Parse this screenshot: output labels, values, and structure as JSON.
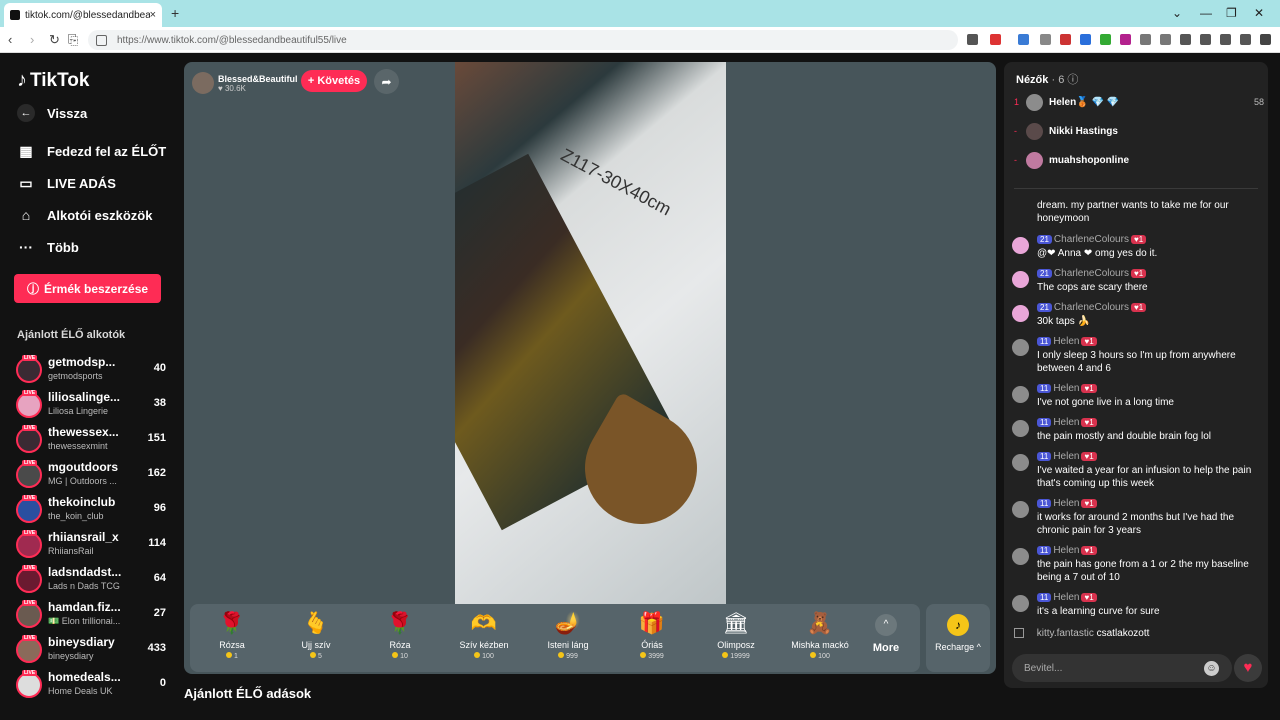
{
  "browser": {
    "tab_title": "tiktok.com/@blessedandbeau",
    "url": "https://www.tiktok.com/@blessedandbeautiful55/live"
  },
  "sidebar": {
    "logo": "TikTok",
    "back": "Vissza",
    "nav": [
      {
        "label": "Fedezd fel az ÉLŐT",
        "icon": "calendar-icon"
      },
      {
        "label": "LIVE ADÁS",
        "icon": "camera-icon"
      },
      {
        "label": "Alkotói eszközök",
        "icon": "creator-tools-icon"
      },
      {
        "label": "Több",
        "icon": "more-dots-icon"
      }
    ],
    "buy_coins": "Érmék beszerzése",
    "suggested_title": "Ajánlott ÉLŐ alkotók",
    "creators": [
      {
        "name": "getmodsp...",
        "sub": "getmodsports",
        "count": "40"
      },
      {
        "name": "liliosalinge...",
        "sub": "Liliosa Lingerie",
        "count": "38"
      },
      {
        "name": "thewessex...",
        "sub": "thewessexmint",
        "count": "151"
      },
      {
        "name": "mgoutdoors",
        "sub": "MG | Outdoors ...",
        "count": "162"
      },
      {
        "name": "thekoinclub",
        "sub": "the_koin_club",
        "count": "96"
      },
      {
        "name": "rhiiansrail_x",
        "sub": "RhiiansRail",
        "count": "114"
      },
      {
        "name": "ladsndadst...",
        "sub": "Lads n Dads TCG",
        "count": "64"
      },
      {
        "name": "hamdan.fiz...",
        "sub": "💵 Elon trillionai...",
        "count": "27"
      },
      {
        "name": "bineysdiary",
        "sub": "bineysdiary",
        "count": "433"
      },
      {
        "name": "homedeals...",
        "sub": "Home Deals UK",
        "count": "0"
      }
    ]
  },
  "player": {
    "host_name": "Blessed&Beautiful",
    "host_likes": "30.6K",
    "follow": "+ Követés",
    "video_code": "Z117-30X40cm",
    "gifts": [
      {
        "name": "Rózsa",
        "price": "1",
        "icon": "🌹"
      },
      {
        "name": "Ujj szív",
        "price": "5",
        "icon": "🫰"
      },
      {
        "name": "Róza",
        "price": "10",
        "icon": "🌹"
      },
      {
        "name": "Szív kézben",
        "price": "100",
        "icon": "🫶"
      },
      {
        "name": "Isteni láng",
        "price": "999",
        "icon": "🪔"
      },
      {
        "name": "Óriás",
        "price": "3999",
        "icon": "🎁"
      },
      {
        "name": "Olimposz",
        "price": "19999",
        "icon": "🏛"
      },
      {
        "name": "Mishka mackó",
        "price": "100",
        "icon": "🧸"
      }
    ],
    "more": "More",
    "recharge": "Recharge ^"
  },
  "suggested_lives_title": "Ajánlott ÉLŐ adások",
  "chat": {
    "viewers_label": "Nézők",
    "viewers_count": "· 6",
    "viewers": [
      {
        "rank": "1",
        "name": "Helen🥉 💎 💎",
        "score": "58"
      },
      {
        "rank": "-",
        "name": "Nikki Hastings",
        "score": ""
      },
      {
        "rank": "-",
        "name": "muahshoponline",
        "score": ""
      }
    ],
    "messages": [
      {
        "user": "",
        "level": "",
        "text": "dream. my partner wants to take me for our honeymoon"
      },
      {
        "user": "CharleneColours",
        "level": "21",
        "text": "@❤ Anna ❤ omg yes do it."
      },
      {
        "user": "CharleneColours",
        "level": "21",
        "text": "The cops are scary there"
      },
      {
        "user": "CharleneColours",
        "level": "21",
        "text": "30k taps 🍌"
      },
      {
        "user": "Helen",
        "level": "11",
        "text": "I only sleep 3 hours so I'm up from anywhere between 4 and 6"
      },
      {
        "user": "Helen",
        "level": "11",
        "text": "I've not gone live in a long time"
      },
      {
        "user": "Helen",
        "level": "11",
        "text": "the pain mostly and double brain fog lol"
      },
      {
        "user": "Helen",
        "level": "11",
        "text": "I've waited a year for an infusion to help the pain that's coming up this week"
      },
      {
        "user": "Helen",
        "level": "11",
        "text": "it works for around 2 months but I've had the chronic pain for 3 years"
      },
      {
        "user": "Helen",
        "level": "11",
        "text": "the pain has gone from a 1 or 2 the my baseline being a 7 out of 10"
      },
      {
        "user": "Helen",
        "level": "11",
        "text": "it's a learning curve for sure"
      }
    ],
    "joined_user": "kitty.fantastic",
    "joined_text": "csatlakozott",
    "input_placeholder": "Bevitel..."
  }
}
